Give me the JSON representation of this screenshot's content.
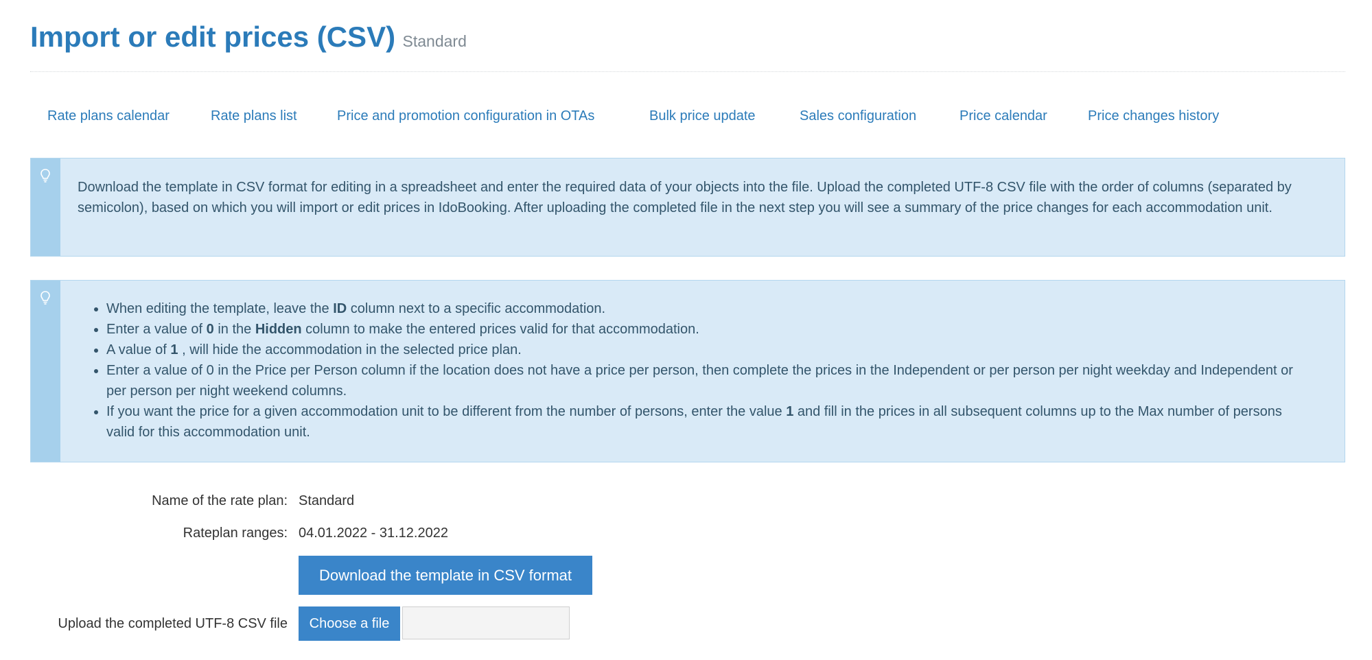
{
  "header": {
    "title": "Import or edit prices (CSV)",
    "subtitle": "Standard"
  },
  "tabs": [
    {
      "label": "Rate plans calendar"
    },
    {
      "label": "Rate plans list"
    },
    {
      "label": "Price and promotion configuration in OTAs"
    },
    {
      "label": "Bulk price update"
    },
    {
      "label": "Sales configuration"
    },
    {
      "label": "Price calendar"
    },
    {
      "label": "Price changes history"
    }
  ],
  "info_box_1": {
    "icon": "lightbulb-icon",
    "text": "Download the template in CSV format for editing in a spreadsheet and enter the required data of your objects into the file. Upload the completed UTF-8 CSV file with the order of columns (separated by semicolon), based on which you will import or edit prices in IdoBooking. After uploading the completed file in the next step you will see a summary of the price changes for each accommodation unit."
  },
  "info_box_2": {
    "icon": "lightbulb-icon",
    "items": [
      {
        "t1": "When editing the template, leave the ",
        "b1": "ID",
        "t2": " column next to a specific accommodation.",
        "b2": "",
        "t3": ""
      },
      {
        "t1": "Enter a value of ",
        "b1": "0",
        "t2": " in the ",
        "b2": "Hidden",
        "t3": " column to make the entered prices valid for that accommodation."
      },
      {
        "t1": "A value of ",
        "b1": "1",
        "t2": " , will hide the accommodation in the selected price plan.",
        "b2": "",
        "t3": ""
      },
      {
        "t1": "Enter a value of 0 in the Price per Person column if the location does not have a price per person, then complete the prices in the Independent or per person per night weekday and Independent or per person per night weekend columns.",
        "b1": "",
        "t2": "",
        "b2": "",
        "t3": ""
      },
      {
        "t1": "If you want the price for a given accommodation unit to be different from the number of persons, enter the value ",
        "b1": "1",
        "t2": " and fill in the prices in all subsequent columns up to the Max number of persons valid for this accommodation unit.",
        "b2": "",
        "t3": ""
      }
    ]
  },
  "form": {
    "rate_plan_label": "Name of the rate plan:",
    "rate_plan_value": "Standard",
    "ranges_label": "Rateplan ranges:",
    "ranges_value": "04.01.2022 - 31.12.2022",
    "download_button": "Download the template in CSV format",
    "upload_label": "Upload the completed UTF-8 CSV file",
    "choose_button": "Choose a file",
    "file_value": ""
  },
  "colors": {
    "accent": "#2b7bb9",
    "button": "#3a85c9",
    "info_background": "#d9eaf7",
    "info_strip": "#a6d0ec"
  }
}
